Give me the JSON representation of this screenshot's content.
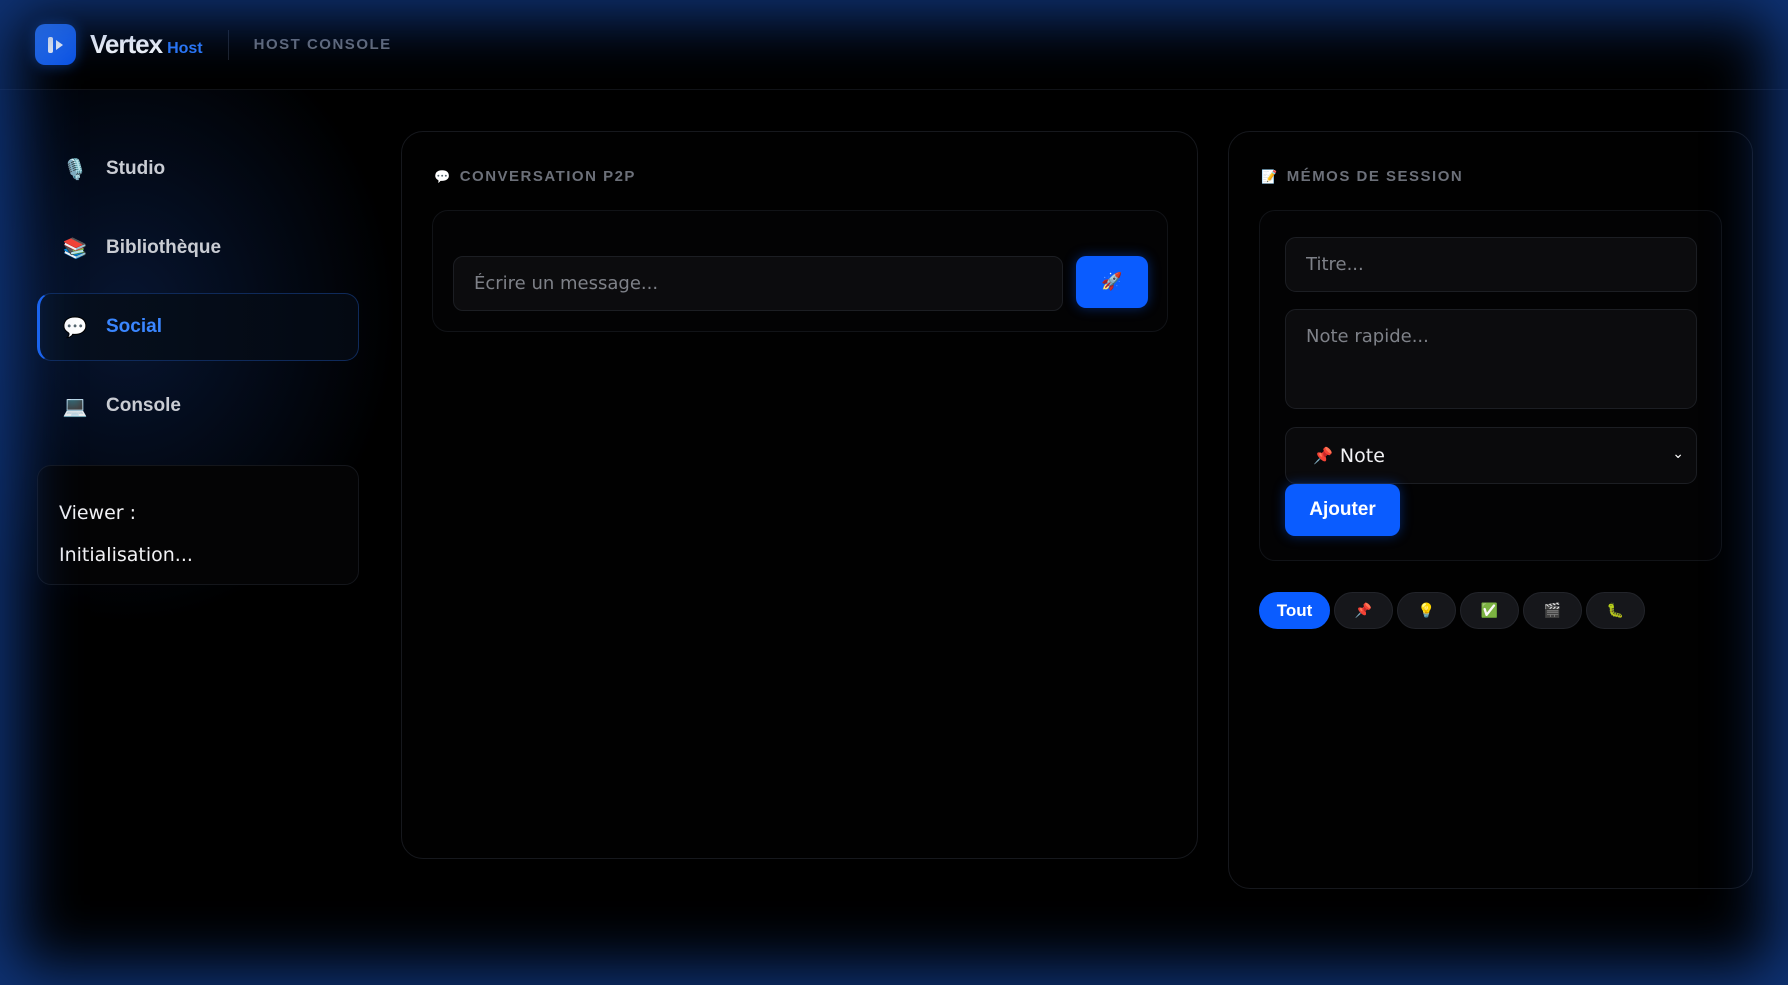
{
  "header": {
    "brand_name": "Vertex",
    "brand_sub": "Host",
    "section_title": "HOST CONSOLE"
  },
  "sidebar": {
    "items": [
      {
        "label": "Studio",
        "icon": "microphone-icon",
        "glyph": "🎙️",
        "active": false
      },
      {
        "label": "Bibliothèque",
        "icon": "books-icon",
        "glyph": "📚",
        "active": false
      },
      {
        "label": "Social",
        "icon": "speech-bubble-icon",
        "glyph": "💬",
        "active": true
      },
      {
        "label": "Console",
        "icon": "laptop-icon",
        "glyph": "💻",
        "active": false
      }
    ],
    "viewer_label": "Viewer :",
    "viewer_status": "Initialisation..."
  },
  "chat": {
    "title": "CONVERSATION P2P",
    "title_glyph": "💬",
    "input_placeholder": "Écrire un message...",
    "send_glyph": "🚀"
  },
  "memos": {
    "title": "MÉMOS DE SESSION",
    "title_glyph": "📝",
    "title_placeholder": "Titre...",
    "note_placeholder": "Note rapide...",
    "type_selected": "Note",
    "type_glyph": "📌",
    "add_label": "Ajouter",
    "filters": [
      {
        "label": "Tout",
        "active": true
      },
      {
        "label": "📌",
        "icon": "pin-icon"
      },
      {
        "label": "💡",
        "icon": "lightbulb-icon"
      },
      {
        "label": "✅",
        "icon": "checkmark-icon"
      },
      {
        "label": "🎬",
        "icon": "clapper-icon"
      },
      {
        "label": "🐛",
        "icon": "bug-icon"
      }
    ]
  },
  "colors": {
    "accent": "#0a5cff",
    "accent_text": "#3a86ff",
    "background": "#000000"
  }
}
